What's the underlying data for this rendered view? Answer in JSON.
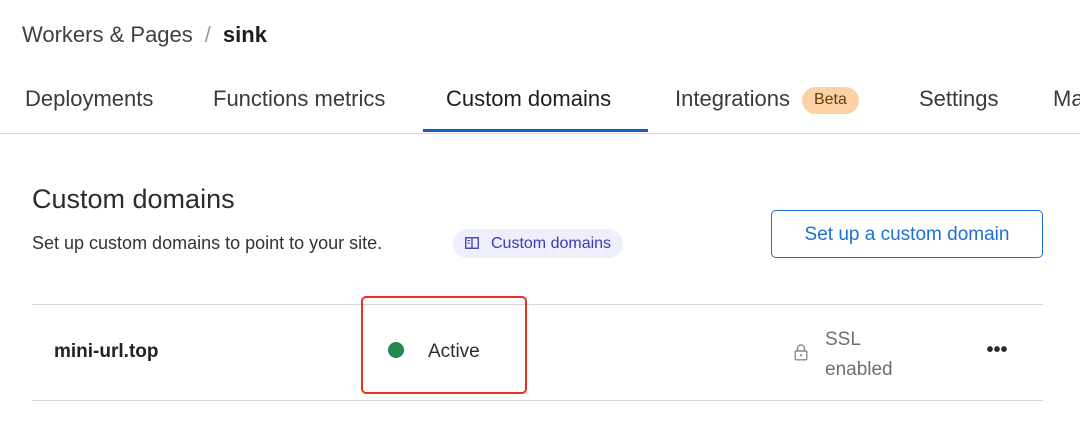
{
  "breadcrumb": {
    "parent": "Workers & Pages",
    "separator": "/",
    "current": "sink"
  },
  "tabs": [
    {
      "label": "Deployments",
      "active": false
    },
    {
      "label": "Functions metrics",
      "active": false
    },
    {
      "label": "Custom domains",
      "active": true
    },
    {
      "label": "Integrations",
      "active": false,
      "badge": "Beta"
    },
    {
      "label": "Settings",
      "active": false
    },
    {
      "label": "Ma",
      "active": false
    }
  ],
  "section": {
    "title": "Custom domains",
    "description": "Set up custom domains to point to your site.",
    "doc_link": "Custom domains",
    "setup_button": "Set up a custom domain"
  },
  "domains": [
    {
      "name": "mini-url.top",
      "status": "Active",
      "ssl_line1": "SSL",
      "ssl_line2": "enabled",
      "more": "•••"
    }
  ],
  "colors": {
    "accent": "#0b5fc6",
    "status_active": "#23884f",
    "badge_bg": "#fbd2a6",
    "highlight": "#e8321f"
  },
  "icons": {
    "doc_chip": "book-icon",
    "ssl": "lock-icon",
    "more": "ellipsis-icon"
  }
}
